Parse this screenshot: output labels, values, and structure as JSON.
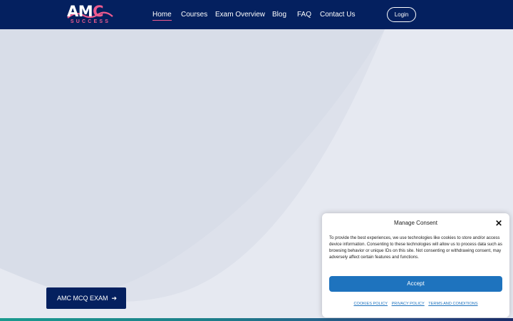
{
  "header": {
    "logo_text_white": "AM",
    "logo_text_pink": "C",
    "logo_sub": "SUCCESS",
    "nav": [
      {
        "label": "Home",
        "active": true
      },
      {
        "label": "Courses",
        "active": false
      },
      {
        "label": "Exam Overview",
        "active": false
      },
      {
        "label": "Blog",
        "active": false
      },
      {
        "label": "FAQ",
        "active": false
      },
      {
        "label": "Contact Us",
        "active": false
      }
    ],
    "login_label": "Login"
  },
  "hero": {
    "cta_label": "AMC MCQ EXAM",
    "cta_icon": "arrow-right-icon"
  },
  "consent": {
    "title": "Manage Consent",
    "close_icon": "close-icon",
    "body": "To provide the best experiences, we use technologies like cookies to store and/or access device information. Consenting to these technologies will allow us to process data such as browsing behavior or unique IDs on this site. Not consenting or withdrawing consent, may adversely affect certain features and functions.",
    "accept_label": "Accept",
    "links": [
      "COOKIES POLICY",
      "PRIVACY POLICY",
      "TERMS AND CONDITIONS"
    ]
  },
  "colors": {
    "header_bg": "#04205f",
    "brand_pink": "#ef5b8e",
    "accept_blue": "#1e73be",
    "hero_bg": "#e6e9f1"
  }
}
